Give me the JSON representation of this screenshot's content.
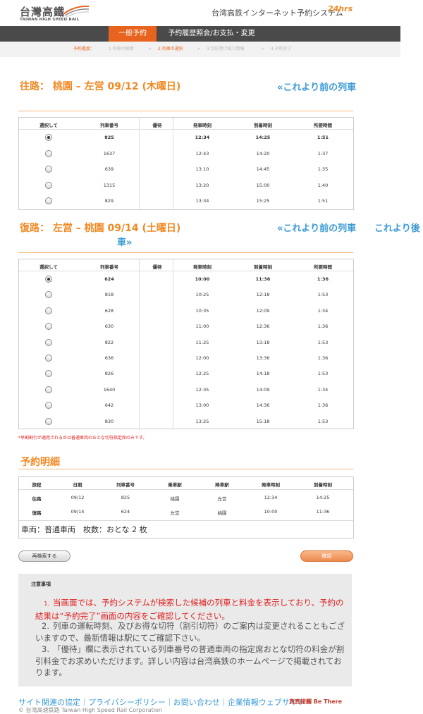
{
  "header": {
    "logo_main": "台灣高鐵",
    "logo_sub": "TAIWAN HIGH SPEED RAIL",
    "system_title": "台湾高鉄インターネット予約システム",
    "badge_24": "24hrs"
  },
  "nav": {
    "items": [
      "一般予約",
      "予約履歴照会/お支払・変更"
    ],
    "active_index": 0
  },
  "progress": {
    "label": "予約進度：",
    "steps": [
      "1.列車の検索",
      "2.列車の選択",
      "3.切符受け取り情報",
      "4.予約完了"
    ],
    "separator": ">",
    "current": 1
  },
  "outbound": {
    "title": "往路： 桃園 – 左営 09/12 (木曜日)",
    "earlier_link": "«これより前の列車",
    "columns": [
      "選択して",
      "列車番号",
      "優待",
      "発車時刻",
      "到着時刻",
      "所要時間"
    ],
    "rows": [
      {
        "train": "825",
        "discount": "",
        "depart": "12:34",
        "arrive": "14:25",
        "duration": "1:51",
        "selected": true
      },
      {
        "train": "1637",
        "discount": "",
        "depart": "12:43",
        "arrive": "14:20",
        "duration": "1:37",
        "selected": false
      },
      {
        "train": "639",
        "discount": "",
        "depart": "13:10",
        "arrive": "14:45",
        "duration": "1:35",
        "selected": false
      },
      {
        "train": "1315",
        "discount": "",
        "depart": "13:20",
        "arrive": "15:00",
        "duration": "1:40",
        "selected": false
      },
      {
        "train": "829",
        "discount": "",
        "depart": "13:34",
        "arrive": "15:25",
        "duration": "1:51",
        "selected": false
      }
    ]
  },
  "return": {
    "title": "復路： 左営 – 桃園 09/14 (土曜日)",
    "earlier_link": "«これより前の列車",
    "later_link_1": "これより後",
    "later_link_2": "車»",
    "columns": [
      "選択して",
      "列車番号",
      "優待",
      "発車時刻",
      "到着時刻",
      "所要時間"
    ],
    "rows": [
      {
        "train": "624",
        "discount": "",
        "depart": "10:00",
        "arrive": "11:36",
        "duration": "1:36",
        "selected": true
      },
      {
        "train": "818",
        "discount": "",
        "depart": "10:25",
        "arrive": "12:18",
        "duration": "1:53",
        "selected": false
      },
      {
        "train": "628",
        "discount": "",
        "depart": "10:35",
        "arrive": "12:09",
        "duration": "1:34",
        "selected": false
      },
      {
        "train": "630",
        "discount": "",
        "depart": "11:00",
        "arrive": "12:36",
        "duration": "1:36",
        "selected": false
      },
      {
        "train": "822",
        "discount": "",
        "depart": "11:25",
        "arrive": "13:18",
        "duration": "1:53",
        "selected": false
      },
      {
        "train": "636",
        "discount": "",
        "depart": "12:00",
        "arrive": "13:36",
        "duration": "1:36",
        "selected": false
      },
      {
        "train": "826",
        "discount": "",
        "depart": "12:25",
        "arrive": "14:18",
        "duration": "1:53",
        "selected": false
      },
      {
        "train": "1640",
        "discount": "",
        "depart": "12:35",
        "arrive": "14:09",
        "duration": "1:34",
        "selected": false
      },
      {
        "train": "642",
        "discount": "",
        "depart": "13:00",
        "arrive": "14:36",
        "duration": "1:36",
        "selected": false
      },
      {
        "train": "830",
        "discount": "",
        "depart": "13:25",
        "arrive": "15:18",
        "duration": "1:53",
        "selected": false
      }
    ],
    "note": "*早割割引が適用されるのは普通車両のおとな切符指定席のみです。"
  },
  "details": {
    "title": "予約明細",
    "columns": [
      "旅程",
      "日期",
      "列車番号",
      "乗車駅",
      "降車駅",
      "発車時刻",
      "到着時刻"
    ],
    "rows": [
      [
        "往路",
        "09/12",
        "825",
        "桃園",
        "左営",
        "12:34",
        "14:25"
      ],
      [
        "復路",
        "09/14",
        "624",
        "左営",
        "桃園",
        "10:00",
        "11:36"
      ]
    ],
    "summary": "車両：普通車両　枚数：おとな 2 枚"
  },
  "buttons": {
    "research": "再検索する",
    "confirm": "確認"
  },
  "notice": {
    "title": "注意事項",
    "items": [
      {
        "num": "1.",
        "text": "当画面では、予約システムが検索した候補の列車と料金を表示しており、予約の結果は“予約完了”画面の内容をご確認してください。",
        "color": "#e02020"
      },
      {
        "num": "2.",
        "text": "列車の運転時刻、及びお得な切符（割引切符）のご案内は変更されることもございますので、最新情報は駅にてご確認下さい。",
        "color": "#555555"
      },
      {
        "num": "3.",
        "text": "「優待」欄に表示されている列車番号の普通車両の指定席おとな切符の料金が割引料金でお求めいただけます。詳しい内容は台湾高鉄のホームページで掲載されております。",
        "color": "#555555"
      }
    ]
  },
  "footer": {
    "links": "サイト関連の協定｜プライバシーポリシー｜お問い合わせ｜企業情報ウェブサイト",
    "copyright": "© 台湾高速鉄路 Taiwan High Speed Rail Corporation",
    "tagline": "真真接觸 Be There"
  },
  "colors": {
    "accent": "#f08a24",
    "nav_active": "#e8641e",
    "link": "#3a9bd5",
    "warning": "#e02020",
    "navbar": "#4a4a4a"
  }
}
